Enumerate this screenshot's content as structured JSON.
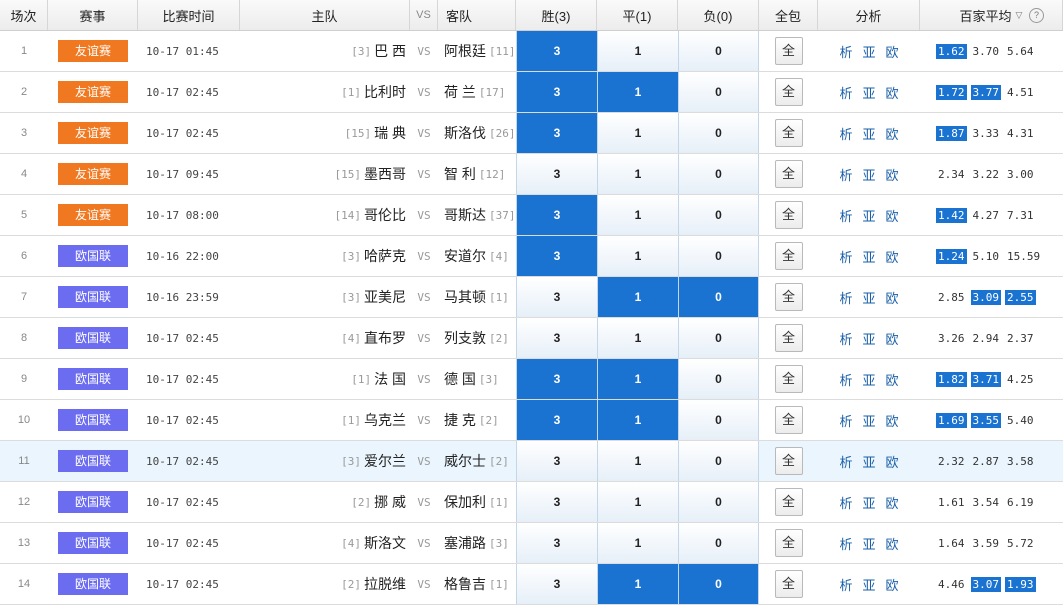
{
  "header": {
    "no": "场次",
    "league": "赛事",
    "time": "比赛时间",
    "home": "主队",
    "vs": "VS",
    "away": "客队",
    "win": "胜(3)",
    "draw": "平(1)",
    "lose": "负(0)",
    "all": "全包",
    "analysis": "分析",
    "avg": "百家平均",
    "caret": "▽",
    "help": "?"
  },
  "labels": {
    "all_btn": "全",
    "an1": "析",
    "an2": "亚",
    "an3": "欧",
    "vs": "VS"
  },
  "colors": {
    "friendly": "#f07820",
    "euro": "#6c6cf0",
    "selected": "#1a73d0"
  },
  "rows": [
    {
      "no": "1",
      "league": "友谊赛",
      "type": "friendly",
      "time": "10-17 01:45",
      "home_rank": "[3]",
      "home": "巴 西",
      "away": "阿根廷",
      "away_rank": "[11]",
      "win": "3",
      "draw": "1",
      "lose": "0",
      "sel": [
        1,
        0,
        0
      ],
      "odds": [
        "1.62",
        "3.70",
        "5.64"
      ],
      "osel": [
        1,
        0,
        0
      ]
    },
    {
      "no": "2",
      "league": "友谊赛",
      "type": "friendly",
      "time": "10-17 02:45",
      "home_rank": "[1]",
      "home": "比利时",
      "away": "荷 兰",
      "away_rank": "[17]",
      "win": "3",
      "draw": "1",
      "lose": "0",
      "sel": [
        1,
        1,
        0
      ],
      "odds": [
        "1.72",
        "3.77",
        "4.51"
      ],
      "osel": [
        1,
        1,
        0
      ]
    },
    {
      "no": "3",
      "league": "友谊赛",
      "type": "friendly",
      "time": "10-17 02:45",
      "home_rank": "[15]",
      "home": "瑞 典",
      "away": "斯洛伐",
      "away_rank": "[26]",
      "win": "3",
      "draw": "1",
      "lose": "0",
      "sel": [
        1,
        0,
        0
      ],
      "odds": [
        "1.87",
        "3.33",
        "4.31"
      ],
      "osel": [
        1,
        0,
        0
      ]
    },
    {
      "no": "4",
      "league": "友谊赛",
      "type": "friendly",
      "time": "10-17 09:45",
      "home_rank": "[15]",
      "home": "墨西哥",
      "away": "智 利",
      "away_rank": "[12]",
      "win": "3",
      "draw": "1",
      "lose": "0",
      "sel": [
        0,
        0,
        0
      ],
      "odds": [
        "2.34",
        "3.22",
        "3.00"
      ],
      "osel": [
        0,
        0,
        0
      ]
    },
    {
      "no": "5",
      "league": "友谊赛",
      "type": "friendly",
      "time": "10-17 08:00",
      "home_rank": "[14]",
      "home": "哥伦比",
      "away": "哥斯达",
      "away_rank": "[37]",
      "win": "3",
      "draw": "1",
      "lose": "0",
      "sel": [
        1,
        0,
        0
      ],
      "odds": [
        "1.42",
        "4.27",
        "7.31"
      ],
      "osel": [
        1,
        0,
        0
      ]
    },
    {
      "no": "6",
      "league": "欧国联",
      "type": "euro",
      "time": "10-16 22:00",
      "home_rank": "[3]",
      "home": "哈萨克",
      "away": "安道尔",
      "away_rank": "[4]",
      "win": "3",
      "draw": "1",
      "lose": "0",
      "sel": [
        1,
        0,
        0
      ],
      "odds": [
        "1.24",
        "5.10",
        "15.59"
      ],
      "osel": [
        1,
        0,
        0
      ]
    },
    {
      "no": "7",
      "league": "欧国联",
      "type": "euro",
      "time": "10-16 23:59",
      "home_rank": "[3]",
      "home": "亚美尼",
      "away": "马其顿",
      "away_rank": "[1]",
      "win": "3",
      "draw": "1",
      "lose": "0",
      "sel": [
        0,
        1,
        1
      ],
      "odds": [
        "2.85",
        "3.09",
        "2.55"
      ],
      "osel": [
        0,
        1,
        1
      ]
    },
    {
      "no": "8",
      "league": "欧国联",
      "type": "euro",
      "time": "10-17 02:45",
      "home_rank": "[4]",
      "home": "直布罗",
      "away": "列支敦",
      "away_rank": "[2]",
      "win": "3",
      "draw": "1",
      "lose": "0",
      "sel": [
        0,
        0,
        0
      ],
      "odds": [
        "3.26",
        "2.94",
        "2.37"
      ],
      "osel": [
        0,
        0,
        0
      ]
    },
    {
      "no": "9",
      "league": "欧国联",
      "type": "euro",
      "time": "10-17 02:45",
      "home_rank": "[1]",
      "home": "法 国",
      "away": "德 国",
      "away_rank": "[3]",
      "win": "3",
      "draw": "1",
      "lose": "0",
      "sel": [
        1,
        1,
        0
      ],
      "odds": [
        "1.82",
        "3.71",
        "4.25"
      ],
      "osel": [
        1,
        1,
        0
      ]
    },
    {
      "no": "10",
      "league": "欧国联",
      "type": "euro",
      "time": "10-17 02:45",
      "home_rank": "[1]",
      "home": "乌克兰",
      "away": "捷 克",
      "away_rank": "[2]",
      "win": "3",
      "draw": "1",
      "lose": "0",
      "sel": [
        1,
        1,
        0
      ],
      "odds": [
        "1.69",
        "3.55",
        "5.40"
      ],
      "osel": [
        1,
        1,
        0
      ]
    },
    {
      "no": "11",
      "league": "欧国联",
      "type": "euro",
      "time": "10-17 02:45",
      "home_rank": "[3]",
      "home": "爱尔兰",
      "away": "威尔士",
      "away_rank": "[2]",
      "win": "3",
      "draw": "1",
      "lose": "0",
      "sel": [
        0,
        0,
        0
      ],
      "odds": [
        "2.32",
        "2.87",
        "3.58"
      ],
      "osel": [
        0,
        0,
        0
      ],
      "hl": true
    },
    {
      "no": "12",
      "league": "欧国联",
      "type": "euro",
      "time": "10-17 02:45",
      "home_rank": "[2]",
      "home": "挪 威",
      "away": "保加利",
      "away_rank": "[1]",
      "win": "3",
      "draw": "1",
      "lose": "0",
      "sel": [
        0,
        0,
        0
      ],
      "odds": [
        "1.61",
        "3.54",
        "6.19"
      ],
      "osel": [
        0,
        0,
        0
      ]
    },
    {
      "no": "13",
      "league": "欧国联",
      "type": "euro",
      "time": "10-17 02:45",
      "home_rank": "[4]",
      "home": "斯洛文",
      "away": "塞浦路",
      "away_rank": "[3]",
      "win": "3",
      "draw": "1",
      "lose": "0",
      "sel": [
        0,
        0,
        0
      ],
      "odds": [
        "1.64",
        "3.59",
        "5.72"
      ],
      "osel": [
        0,
        0,
        0
      ]
    },
    {
      "no": "14",
      "league": "欧国联",
      "type": "euro",
      "time": "10-17 02:45",
      "home_rank": "[2]",
      "home": "拉脱维",
      "away": "格鲁吉",
      "away_rank": "[1]",
      "win": "3",
      "draw": "1",
      "lose": "0",
      "sel": [
        0,
        1,
        1
      ],
      "odds": [
        "4.46",
        "3.07",
        "1.93"
      ],
      "osel": [
        0,
        1,
        1
      ]
    }
  ]
}
